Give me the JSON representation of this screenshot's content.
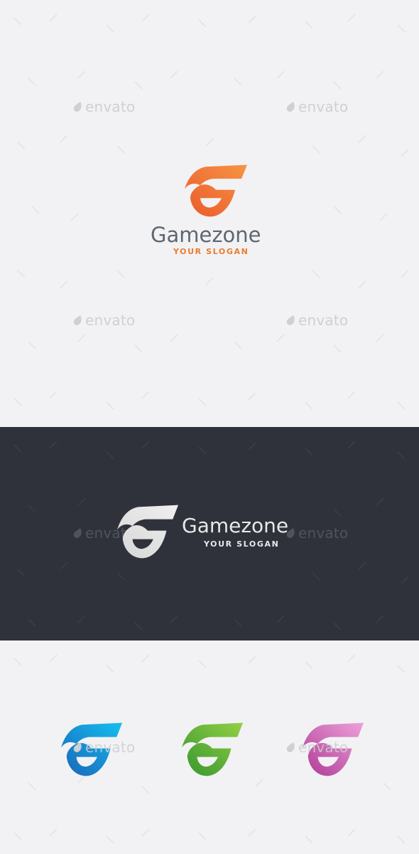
{
  "logo": {
    "brand_name": "Gamezone",
    "slogan": "YOUR SLOGAN"
  },
  "watermark": {
    "text": "envato",
    "icon": "envato-leaf-icon"
  },
  "colors": {
    "light_background": "#f2f2f4",
    "dark_background": "#2f323a",
    "brand_text_light": "#5e6670",
    "brand_text_dark": "#e8e8e8",
    "slogan_orange": "#ef7a2c",
    "slogan_on_dark": "#e8e8e8",
    "mark_orange": [
      "#f79445",
      "#ea5a2a"
    ],
    "mark_white": [
      "#eeeeee",
      "#d8d8d8"
    ],
    "mark_blue": [
      "#13b5ec",
      "#1a6fc0"
    ],
    "mark_green": [
      "#8ccb42",
      "#3d9a2e"
    ],
    "mark_pink": [
      "#ea9ad6",
      "#b53f9a"
    ]
  }
}
